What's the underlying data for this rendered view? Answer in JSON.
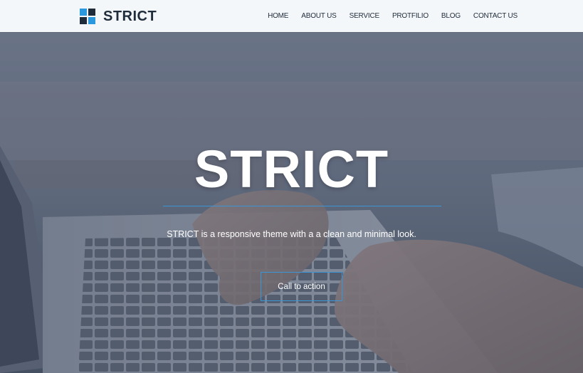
{
  "header": {
    "logo_text": "STRICT",
    "nav": [
      {
        "label": "HOME"
      },
      {
        "label": "ABOUT US"
      },
      {
        "label": "SERVICE"
      },
      {
        "label": "PROTFILIO"
      },
      {
        "label": "BLOG"
      },
      {
        "label": "CONTACT US"
      }
    ]
  },
  "hero": {
    "title": "STRICT",
    "subtitle": "STRICT is a responsive theme with a a clean and minimal look.",
    "cta_label": "Call to action",
    "accent_color": "#3b95d6"
  },
  "colors": {
    "brand_blue": "#2a98de",
    "brand_dark": "#1d2b3a",
    "header_bg": "#f4f7f9"
  }
}
